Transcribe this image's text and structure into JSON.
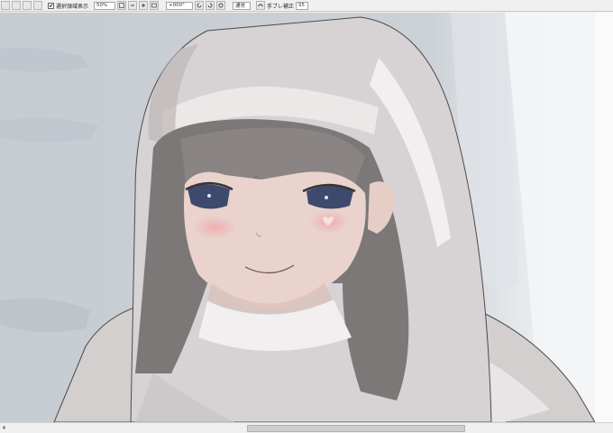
{
  "toolbar": {
    "select_area_label": "選択領域表示",
    "zoom_value": "50%",
    "rotation_value": "+000°",
    "blend_mode": "通常",
    "stabilizer_label": "手ブレ補正",
    "stabilizer_value": "S5"
  },
  "artwork": {
    "subject": "illustration-girl-white-hood",
    "colors": {
      "background": "#c9ced3",
      "hood": "#d7d2d2",
      "hood_shadow": "#b6b0b2",
      "hair": "#7f7a7a",
      "skin": "#e9d2cb",
      "blush": "#f0a3a6",
      "eyes": "#3c4a6e",
      "window_light": "#f6f7f8"
    }
  },
  "scrollbar": {
    "position_fraction": 0.45
  }
}
